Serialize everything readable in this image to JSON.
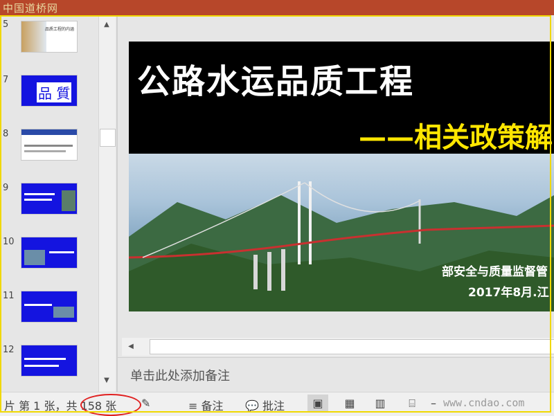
{
  "watermark": {
    "top": "中国道桥网",
    "bottom": "www.cndao.com"
  },
  "thumbnails": {
    "items": [
      {
        "num": "5",
        "title": "品质工程的内涵"
      },
      {
        "num": "7",
        "title": "品 質"
      },
      {
        "num": "8",
        "title": ""
      },
      {
        "num": "9",
        "title": ""
      },
      {
        "num": "10",
        "title": ""
      },
      {
        "num": "11",
        "title": ""
      },
      {
        "num": "12",
        "title": ""
      }
    ]
  },
  "slide": {
    "title": "公路水运品质工程",
    "subtitle": "——相关政策解",
    "org": "部安全与质量监督管",
    "date": "2017年8月.江"
  },
  "notes": {
    "placeholder": "单击此处添加备注"
  },
  "status": {
    "slide_info": "片 第 1 张，共 158 张",
    "notes_label": "备注",
    "comments_label": "批注"
  },
  "colors": {
    "titlebar": "#b7472a",
    "highlight_border": "#f0d800",
    "subtitle": "#ffe600",
    "thumb_blue": "#1414e0",
    "annotation_circle": "#e02020"
  }
}
